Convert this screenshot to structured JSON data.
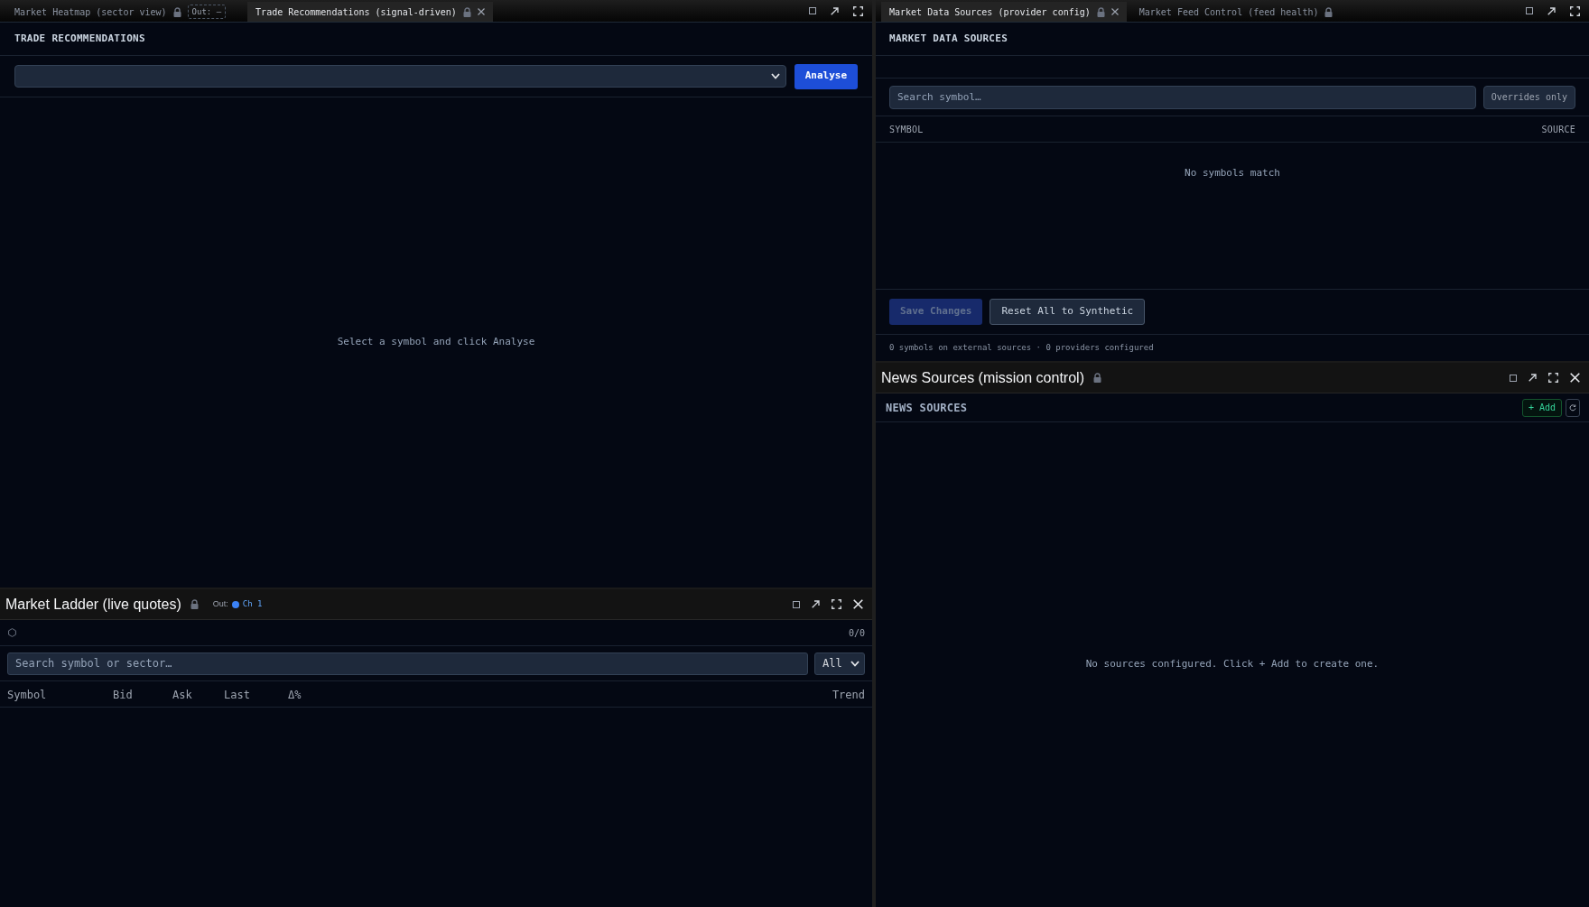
{
  "trade_panel": {
    "tabs": [
      {
        "label": "Market Heatmap (sector view)",
        "selected": false,
        "locked": true,
        "closable": false,
        "out": "Out: –"
      },
      {
        "label": "Trade Recommendations (signal-driven)",
        "selected": true,
        "locked": true,
        "closable": true
      }
    ],
    "heading": "TRADE RECOMMENDATIONS",
    "analyse_button": "Analyse",
    "empty_message": "Select a symbol and click Analyse"
  },
  "market_ladder": {
    "title": "Market Ladder (live quotes)",
    "locked": true,
    "output": {
      "label": "Out:",
      "channel": "Ch 1"
    },
    "count": "0/0",
    "search": {
      "placeholder": "Search symbol or sector…"
    },
    "filter": {
      "value": "All"
    },
    "columns": [
      "Symbol",
      "Bid",
      "Ask",
      "Last",
      "Δ%",
      "Trend"
    ]
  },
  "data_sources_panel": {
    "tabs": [
      {
        "label": "Market Data Sources (provider config)",
        "selected": true,
        "locked": true,
        "closable": true
      },
      {
        "label": "Market Feed Control (feed health)",
        "selected": false,
        "locked": true,
        "closable": false
      }
    ],
    "heading": "MARKET DATA SOURCES",
    "search": {
      "placeholder": "Search symbol…"
    },
    "overrides_button": "Overrides only",
    "columns": [
      "SYMBOL",
      "SOURCE"
    ],
    "empty_message": "No symbols match",
    "buttons": [
      {
        "label": "Save Changes",
        "kind": "primary",
        "disabled": true
      },
      {
        "label": "Reset All to Synthetic",
        "kind": "secondary",
        "disabled": false
      }
    ],
    "summary": "0 symbols on external sources · 0 providers configured"
  },
  "news_sources": {
    "title": "News Sources (mission control)",
    "locked": true,
    "heading": "NEWS SOURCES",
    "add_button": "+ Add",
    "empty_message": "No sources configured. Click + Add to create one."
  }
}
